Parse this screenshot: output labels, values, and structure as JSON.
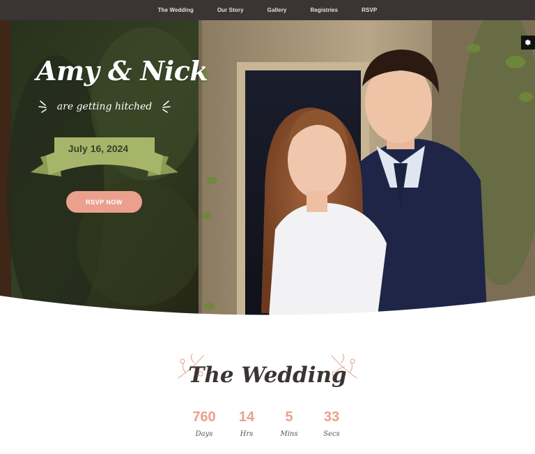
{
  "nav": {
    "items": [
      "The Wedding",
      "Our Story",
      "Gallery",
      "Registries",
      "RSVP"
    ]
  },
  "hero": {
    "names": "Amy & Nick",
    "tagline": "are getting hitched",
    "date": "July 16, 2024",
    "rsvp_label": "RSVP NOW"
  },
  "wedding": {
    "title": "The Wedding",
    "countdown": [
      {
        "value": "760",
        "label": "Days"
      },
      {
        "value": "14",
        "label": "Hrs"
      },
      {
        "value": "5",
        "label": "Mins"
      },
      {
        "value": "33",
        "label": "Secs"
      }
    ]
  },
  "colors": {
    "nav_bg": "#3b3434",
    "accent": "#eba08d",
    "ribbon": "#a7b56a",
    "heading": "#3b3434"
  },
  "icons": {
    "settings": "gear-icon"
  }
}
